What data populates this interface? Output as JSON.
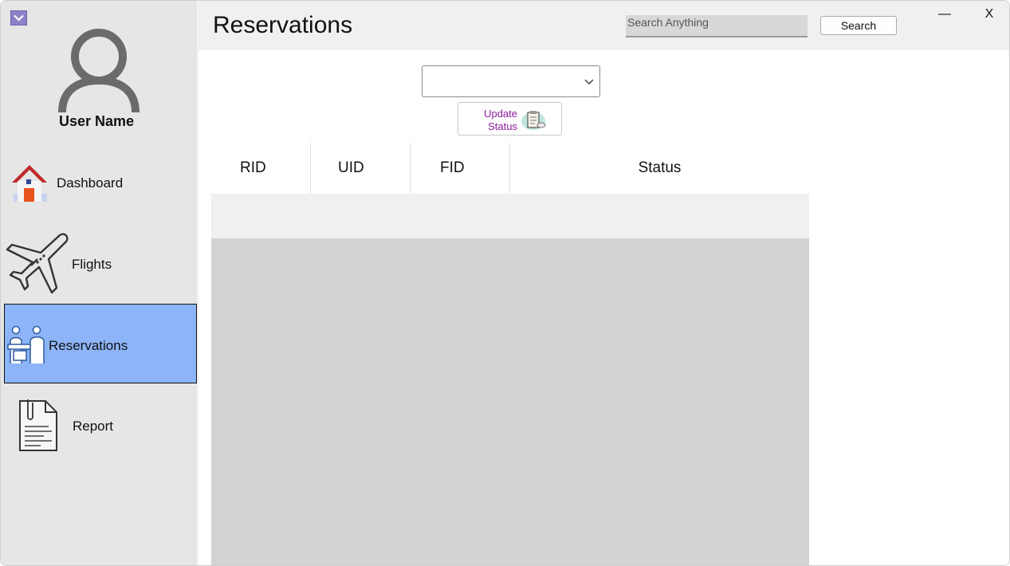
{
  "sidebar": {
    "user_name": "User Name",
    "items": [
      {
        "label": "Dashboard",
        "icon": "house-icon",
        "active": false
      },
      {
        "label": "Flights",
        "icon": "airplane-icon",
        "active": false
      },
      {
        "label": "Reservations",
        "icon": "check-in-counter-icon",
        "active": true
      },
      {
        "label": "Report",
        "icon": "document-icon",
        "active": false
      }
    ]
  },
  "header": {
    "title": "Reservations",
    "search_placeholder": "Search Anything",
    "search_button": "Search",
    "minimize": "—",
    "close": "X"
  },
  "content": {
    "status_select_value": "",
    "update_status_label_line1": "Update",
    "update_status_label_line2": "Status",
    "columns": [
      "RID",
      "UID",
      "FID",
      "Status"
    ],
    "rows": []
  },
  "colors": {
    "sidebar_bg": "#e6e6e6",
    "active_item_bg": "#8cb4f7",
    "header_bg": "#f0f0f0",
    "grid_body_bg": "#d3d3d3",
    "update_label": "#8a1a9a"
  }
}
